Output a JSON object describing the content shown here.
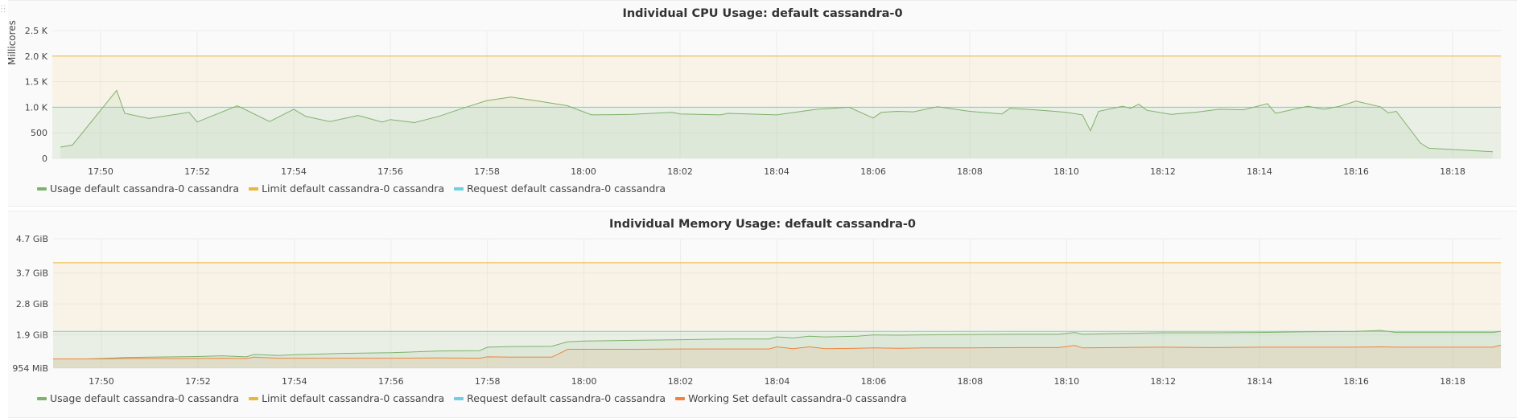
{
  "panels": {
    "cpu": {
      "title": "Individual CPU Usage: default cassandra-0",
      "ylabel": "Millicores",
      "legend": [
        {
          "label": "Usage default cassandra-0 cassandra",
          "color": "#7eb26d"
        },
        {
          "label": "Limit default cassandra-0 cassandra",
          "color": "#eab839"
        },
        {
          "label": "Request default cassandra-0 cassandra",
          "color": "#6ed0e0"
        }
      ]
    },
    "mem": {
      "title": "Individual Memory Usage: default cassandra-0",
      "legend": [
        {
          "label": "Usage default cassandra-0 cassandra",
          "color": "#7eb26d"
        },
        {
          "label": "Limit default cassandra-0 cassandra",
          "color": "#eab839"
        },
        {
          "label": "Request default cassandra-0 cassandra",
          "color": "#6ed0e0"
        },
        {
          "label": "Working Set default cassandra-0 cassandra",
          "color": "#ef843c"
        }
      ]
    }
  },
  "chart_data": [
    {
      "type": "area",
      "title": "Individual CPU Usage: default cassandra-0",
      "xlabel": "",
      "ylabel": "Millicores",
      "x_unit": "time (HH:MM)",
      "xlim": [
        "17:49",
        "18:19"
      ],
      "ylim": [
        0,
        2500
      ],
      "x_ticks": [
        "17:50",
        "17:52",
        "17:54",
        "17:56",
        "17:58",
        "18:00",
        "18:02",
        "18:04",
        "18:06",
        "18:08",
        "18:10",
        "18:12",
        "18:14",
        "18:16",
        "18:18"
      ],
      "y_ticks": [
        {
          "value": 0,
          "label": "0"
        },
        {
          "value": 500,
          "label": "500"
        },
        {
          "value": 1000,
          "label": "1.0 K"
        },
        {
          "value": 1500,
          "label": "1.5 K"
        },
        {
          "value": 2000,
          "label": "2.0 K"
        },
        {
          "value": 2500,
          "label": "2.5 K"
        }
      ],
      "grid": true,
      "legend_position": "bottom-left",
      "series": [
        {
          "name": "Usage default cassandra-0 cassandra",
          "color": "#7eb26d",
          "fill": true,
          "points": [
            [
              "17:49:10",
              220
            ],
            [
              "17:49:25",
              260
            ],
            [
              "17:50:20",
              1330
            ],
            [
              "17:50:30",
              880
            ],
            [
              "17:51:00",
              780
            ],
            [
              "17:51:50",
              900
            ],
            [
              "17:52:00",
              710
            ],
            [
              "17:52:50",
              1030
            ],
            [
              "17:53:30",
              720
            ],
            [
              "17:54:00",
              960
            ],
            [
              "17:54:15",
              820
            ],
            [
              "17:54:45",
              720
            ],
            [
              "17:55:20",
              840
            ],
            [
              "17:55:50",
              710
            ],
            [
              "17:56:00",
              760
            ],
            [
              "17:56:30",
              700
            ],
            [
              "17:57:00",
              820
            ],
            [
              "17:57:30",
              980
            ],
            [
              "17:58:00",
              1130
            ],
            [
              "17:58:30",
              1200
            ],
            [
              "17:59:00",
              1130
            ],
            [
              "17:59:40",
              1030
            ],
            [
              "18:00:10",
              850
            ],
            [
              "18:01:00",
              860
            ],
            [
              "18:01:50",
              900
            ],
            [
              "18:02:00",
              870
            ],
            [
              "18:02:50",
              850
            ],
            [
              "18:03:00",
              880
            ],
            [
              "18:03:40",
              860
            ],
            [
              "18:04:00",
              850
            ],
            [
              "18:04:50",
              960
            ],
            [
              "18:05:30",
              1000
            ],
            [
              "18:06:00",
              790
            ],
            [
              "18:06:10",
              900
            ],
            [
              "18:06:30",
              920
            ],
            [
              "18:06:50",
              910
            ],
            [
              "18:07:20",
              1010
            ],
            [
              "18:08:00",
              920
            ],
            [
              "18:08:40",
              870
            ],
            [
              "18:08:50",
              980
            ],
            [
              "18:09:30",
              940
            ],
            [
              "18:10:00",
              900
            ],
            [
              "18:10:20",
              850
            ],
            [
              "18:10:30",
              540
            ],
            [
              "18:10:40",
              920
            ],
            [
              "18:11:10",
              1020
            ],
            [
              "18:11:20",
              980
            ],
            [
              "18:11:30",
              1060
            ],
            [
              "18:11:40",
              940
            ],
            [
              "18:12:10",
              860
            ],
            [
              "18:12:40",
              900
            ],
            [
              "18:13:10",
              960
            ],
            [
              "18:13:40",
              950
            ],
            [
              "18:14:10",
              1070
            ],
            [
              "18:14:20",
              880
            ],
            [
              "18:15:00",
              1020
            ],
            [
              "18:15:10",
              990
            ],
            [
              "18:15:20",
              960
            ],
            [
              "18:15:40",
              1020
            ],
            [
              "18:16:00",
              1120
            ],
            [
              "18:16:30",
              1010
            ],
            [
              "18:16:40",
              890
            ],
            [
              "18:16:50",
              920
            ],
            [
              "18:17:20",
              300
            ],
            [
              "18:17:30",
              200
            ],
            [
              "18:18:50",
              130
            ]
          ]
        },
        {
          "name": "Limit default cassandra-0 cassandra",
          "color": "#eab839",
          "fill": true,
          "points": [
            [
              "17:49",
              2000
            ],
            [
              "18:19",
              2000
            ]
          ]
        },
        {
          "name": "Request default cassandra-0 cassandra",
          "color": "#6ed0e0",
          "fill": true,
          "points": [
            [
              "17:49",
              1000
            ],
            [
              "18:19",
              1000
            ]
          ]
        }
      ]
    },
    {
      "type": "area",
      "title": "Individual Memory Usage: default cassandra-0",
      "xlabel": "",
      "ylabel": "",
      "x_unit": "time (HH:MM)",
      "y_unit": "GiB",
      "xlim": [
        "17:49",
        "18:19"
      ],
      "ylim": [
        0.93,
        4.7
      ],
      "x_ticks": [
        "17:50",
        "17:52",
        "17:54",
        "17:56",
        "17:58",
        "18:00",
        "18:02",
        "18:04",
        "18:06",
        "18:08",
        "18:10",
        "18:12",
        "18:14",
        "18:16",
        "18:18"
      ],
      "y_ticks": [
        {
          "value": 0.93,
          "label": "954 MiB"
        },
        {
          "value": 1.9,
          "label": "1.9 GiB"
        },
        {
          "value": 2.8,
          "label": "2.8 GiB"
        },
        {
          "value": 3.7,
          "label": "3.7 GiB"
        },
        {
          "value": 4.7,
          "label": "4.7 GiB"
        }
      ],
      "grid": true,
      "legend_position": "bottom-left",
      "series": [
        {
          "name": "Usage default cassandra-0 cassandra",
          "color": "#7eb26d",
          "fill": true,
          "points": [
            [
              "17:49",
              1.2
            ],
            [
              "17:49:40",
              1.2
            ],
            [
              "17:50:00",
              1.21
            ],
            [
              "17:50:30",
              1.24
            ],
            [
              "17:51:00",
              1.25
            ],
            [
              "17:52:00",
              1.27
            ],
            [
              "17:52:30",
              1.29
            ],
            [
              "17:53:00",
              1.26
            ],
            [
              "17:53:10",
              1.33
            ],
            [
              "17:53:40",
              1.3
            ],
            [
              "17:54:00",
              1.32
            ],
            [
              "17:55:00",
              1.36
            ],
            [
              "17:56:00",
              1.38
            ],
            [
              "17:57:00",
              1.43
            ],
            [
              "17:57:50",
              1.44
            ],
            [
              "17:58:00",
              1.54
            ],
            [
              "17:58:30",
              1.56
            ],
            [
              "17:59:20",
              1.57
            ],
            [
              "17:59:40",
              1.7
            ],
            [
              "18:00:00",
              1.72
            ],
            [
              "18:01:00",
              1.74
            ],
            [
              "18:02:00",
              1.76
            ],
            [
              "18:03:00",
              1.78
            ],
            [
              "18:03:50",
              1.78
            ],
            [
              "18:04:00",
              1.84
            ],
            [
              "18:04:20",
              1.81
            ],
            [
              "18:04:40",
              1.86
            ],
            [
              "18:05:00",
              1.84
            ],
            [
              "18:05:40",
              1.86
            ],
            [
              "18:06:00",
              1.9
            ],
            [
              "18:06:30",
              1.89
            ],
            [
              "18:07:00",
              1.9
            ],
            [
              "18:08:00",
              1.91
            ],
            [
              "18:09:00",
              1.92
            ],
            [
              "18:09:50",
              1.92
            ],
            [
              "18:10:10",
              1.97
            ],
            [
              "18:10:20",
              1.92
            ],
            [
              "18:11:00",
              1.94
            ],
            [
              "18:12:00",
              1.96
            ],
            [
              "18:13:00",
              1.96
            ],
            [
              "18:14:00",
              1.97
            ],
            [
              "18:15:00",
              1.99
            ],
            [
              "18:16:00",
              2.0
            ],
            [
              "18:16:30",
              2.03
            ],
            [
              "18:16:50",
              1.97
            ],
            [
              "18:17:30",
              1.97
            ],
            [
              "18:18:50",
              1.97
            ],
            [
              "18:19:00",
              2.0
            ]
          ]
        },
        {
          "name": "Working Set default cassandra-0 cassandra",
          "color": "#ef843c",
          "fill": true,
          "points": [
            [
              "17:49",
              1.2
            ],
            [
              "17:49:40",
              1.2
            ],
            [
              "17:50:00",
              1.2
            ],
            [
              "17:50:30",
              1.21
            ],
            [
              "17:51:00",
              1.21
            ],
            [
              "17:52:00",
              1.21
            ],
            [
              "17:52:30",
              1.22
            ],
            [
              "17:53:00",
              1.21
            ],
            [
              "17:53:10",
              1.25
            ],
            [
              "17:53:40",
              1.22
            ],
            [
              "17:54:00",
              1.22
            ],
            [
              "17:55:00",
              1.22
            ],
            [
              "17:56:00",
              1.22
            ],
            [
              "17:57:00",
              1.23
            ],
            [
              "17:57:50",
              1.22
            ],
            [
              "17:58:00",
              1.26
            ],
            [
              "17:58:30",
              1.25
            ],
            [
              "17:59:20",
              1.25
            ],
            [
              "17:59:40",
              1.48
            ],
            [
              "18:00:00",
              1.48
            ],
            [
              "18:01:00",
              1.48
            ],
            [
              "18:02:00",
              1.49
            ],
            [
              "18:03:00",
              1.49
            ],
            [
              "18:03:50",
              1.49
            ],
            [
              "18:04:00",
              1.55
            ],
            [
              "18:04:20",
              1.5
            ],
            [
              "18:04:40",
              1.55
            ],
            [
              "18:05:00",
              1.5
            ],
            [
              "18:05:40",
              1.51
            ],
            [
              "18:06:00",
              1.52
            ],
            [
              "18:06:30",
              1.51
            ],
            [
              "18:07:00",
              1.52
            ],
            [
              "18:08:00",
              1.52
            ],
            [
              "18:09:00",
              1.53
            ],
            [
              "18:09:50",
              1.53
            ],
            [
              "18:10:10",
              1.59
            ],
            [
              "18:10:20",
              1.52
            ],
            [
              "18:11:00",
              1.53
            ],
            [
              "18:12:00",
              1.54
            ],
            [
              "18:13:00",
              1.53
            ],
            [
              "18:14:00",
              1.54
            ],
            [
              "18:15:00",
              1.54
            ],
            [
              "18:16:00",
              1.54
            ],
            [
              "18:16:30",
              1.55
            ],
            [
              "18:16:50",
              1.54
            ],
            [
              "18:17:30",
              1.54
            ],
            [
              "18:18:50",
              1.54
            ],
            [
              "18:19:00",
              1.6
            ]
          ]
        },
        {
          "name": "Limit default cassandra-0 cassandra",
          "color": "#eab839",
          "fill": true,
          "points": [
            [
              "17:49",
              4.0
            ],
            [
              "18:19",
              4.0
            ]
          ]
        },
        {
          "name": "Request default cassandra-0 cassandra",
          "color": "#6ed0e0",
          "fill": true,
          "points": [
            [
              "17:49",
              2.0
            ],
            [
              "18:19",
              2.0
            ]
          ]
        }
      ]
    }
  ]
}
